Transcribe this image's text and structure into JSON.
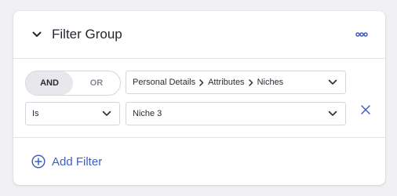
{
  "filter_group": {
    "title": "Filter Group",
    "logic_toggle": {
      "options": [
        {
          "label": "AND",
          "selected": true
        },
        {
          "label": "OR",
          "selected": false
        }
      ]
    },
    "field_path": [
      "Personal Details",
      "Attributes",
      "Niches"
    ],
    "operator": "Is",
    "value": "Niche 3",
    "add_filter_label": "Add Filter"
  },
  "icons": {
    "collapse": "chevron-down-icon",
    "more": "more-dots-icon",
    "dropdown": "chevron-down-icon",
    "separator": "chevron-right-icon",
    "remove": "close-icon",
    "add": "plus-circle-icon"
  },
  "colors": {
    "accent": "#3f5fc4",
    "card_background": "#ffffff",
    "page_background": "#f1f1f3",
    "toggle_active": "#e7e7ec"
  }
}
